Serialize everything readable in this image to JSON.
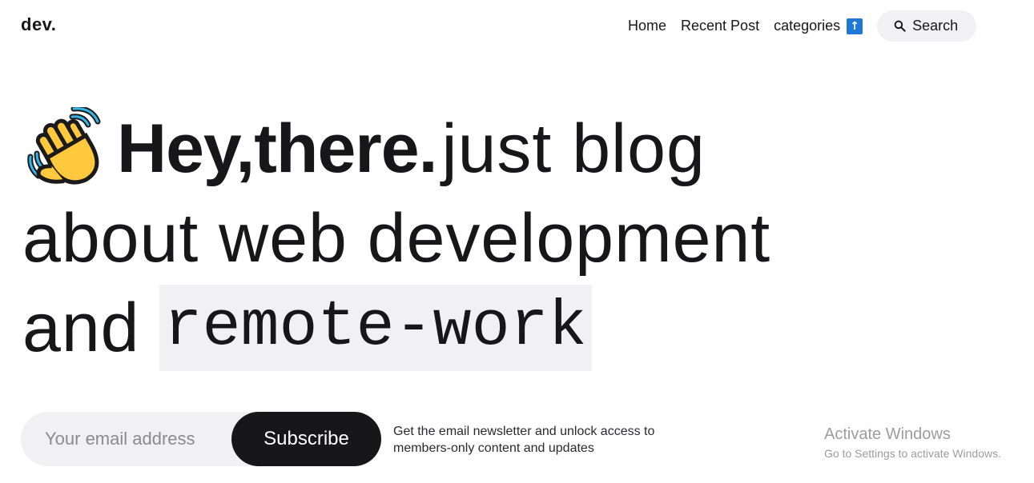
{
  "header": {
    "logo": "dev.",
    "nav": {
      "home": "Home",
      "recent": "Recent Post",
      "categories": "categories",
      "categories_badge": "↑"
    },
    "search_label": "Search"
  },
  "hero": {
    "bold": "Hey,there.",
    "line1_rest": "just blog",
    "line2": "about web development",
    "line3_prefix": "and",
    "highlight": "remote-work"
  },
  "subscribe": {
    "placeholder": "Your email address",
    "button": "Subscribe",
    "note": "Get the email newsletter and unlock access to members-only content and updates"
  },
  "watermark": {
    "title": "Activate Windows",
    "subtitle": "Go to Settings to activate Windows."
  },
  "colors": {
    "text": "#17171a",
    "pill_bg": "#f1f0f2",
    "button_bg": "#17171a",
    "badge_blue": "#1e78d6"
  },
  "icons": {
    "search": "search-icon",
    "wave": "waving-hand-icon",
    "arrow": "up-arrow-icon"
  }
}
